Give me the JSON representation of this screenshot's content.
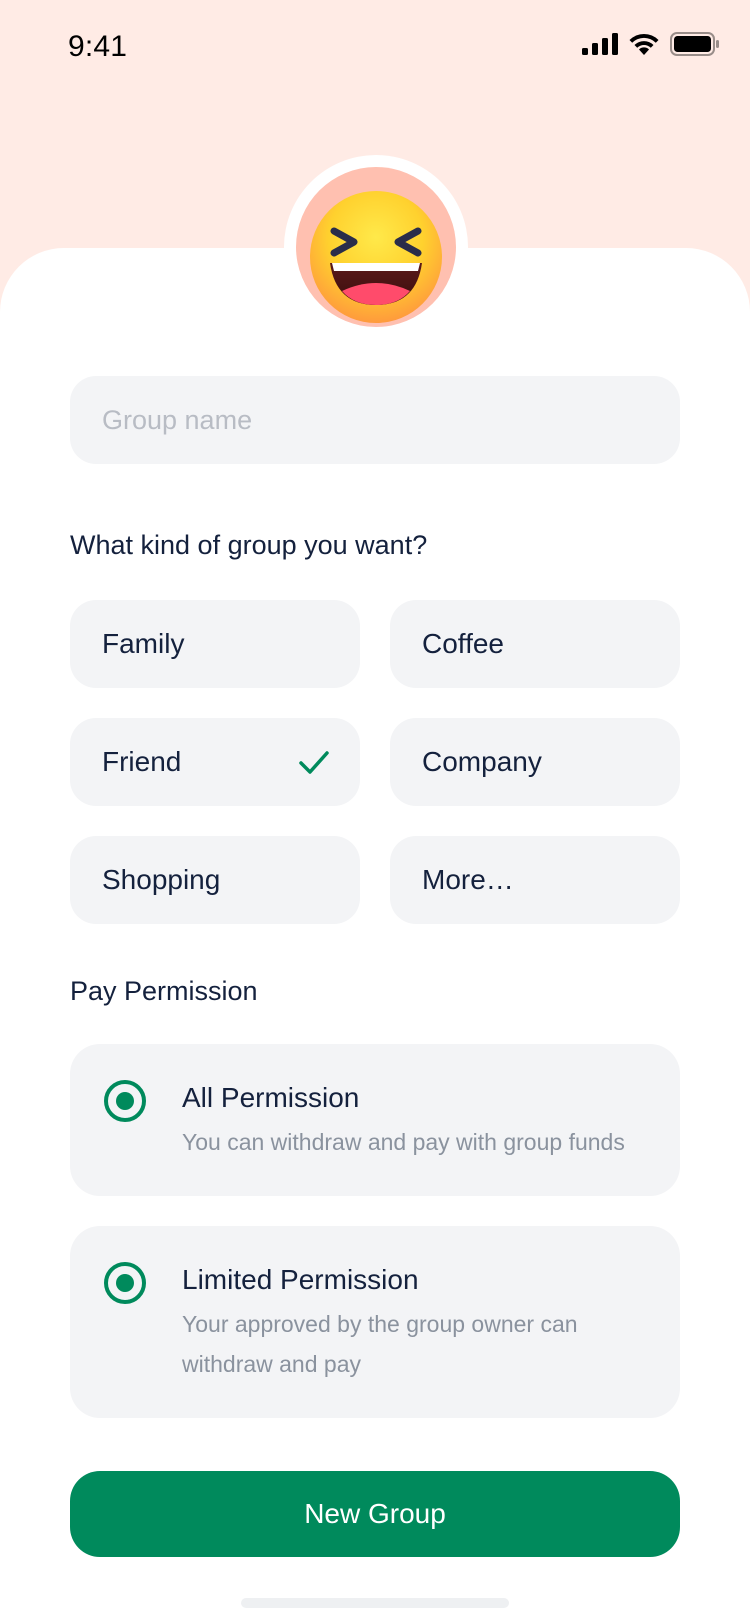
{
  "status_bar": {
    "time": "9:41"
  },
  "form": {
    "group_name_placeholder": "Group name",
    "group_name_value": ""
  },
  "group_kind": {
    "heading": "What kind of group you want?",
    "options": [
      {
        "label": "Family",
        "selected": false
      },
      {
        "label": "Coffee",
        "selected": false
      },
      {
        "label": "Friend",
        "selected": true
      },
      {
        "label": "Company",
        "selected": false
      },
      {
        "label": "Shopping",
        "selected": false
      },
      {
        "label": "More…",
        "selected": false
      }
    ]
  },
  "pay_permission": {
    "heading": "Pay Permission",
    "options": [
      {
        "title": "All Permission",
        "description": "You can withdraw and pay with group funds"
      },
      {
        "title": "Limited Permission",
        "description": "Your approved by the group owner can withdraw and pay"
      }
    ]
  },
  "actions": {
    "submit_label": "New Group"
  },
  "colors": {
    "accent": "#008a5c",
    "header_bg": "#ffebe5",
    "field_bg": "#f3f4f6",
    "text_primary": "#14213d",
    "text_secondary": "#8a929e"
  },
  "icons": {
    "avatar": "laughing-emoji-icon",
    "selected": "checkmark-icon",
    "signal": "cellular-signal-icon",
    "wifi": "wifi-icon",
    "battery": "battery-icon"
  }
}
